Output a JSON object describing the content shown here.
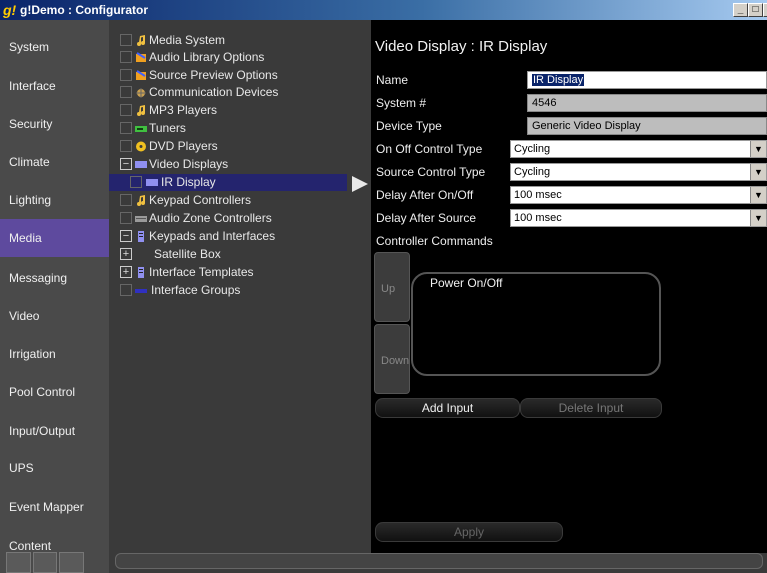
{
  "window": {
    "title": "g!Demo : Configurator",
    "icon": "g!-app-icon"
  },
  "nav": {
    "items": [
      {
        "label": "System"
      },
      {
        "label": "Interface"
      },
      {
        "label": "Security"
      },
      {
        "label": "Climate"
      },
      {
        "label": "Lighting"
      },
      {
        "label": "Media",
        "active": true
      },
      {
        "label": "Messaging"
      },
      {
        "label": "Video"
      },
      {
        "label": "Irrigation"
      },
      {
        "label": "Pool Control"
      },
      {
        "label": "Input/Output"
      },
      {
        "label": "UPS"
      },
      {
        "label": "Event Mapper"
      },
      {
        "label": "Content"
      }
    ]
  },
  "tree": {
    "items": [
      {
        "label": "Media System",
        "icon": "music-note-icon"
      },
      {
        "label": "Audio Library Options",
        "icon": "audio-library-icon"
      },
      {
        "label": "Source Preview Options",
        "icon": "source-preview-icon"
      },
      {
        "label": "Communication Devices",
        "icon": "communication-icon"
      },
      {
        "label": "MP3 Players",
        "icon": "music-note-icon"
      },
      {
        "label": "Tuners",
        "icon": "tuner-icon"
      },
      {
        "label": "DVD Players",
        "icon": "dvd-icon"
      },
      {
        "label": "Video Displays",
        "icon": "display-icon",
        "expander": "−"
      },
      {
        "label": "IR Display",
        "icon": "display-icon",
        "selected": true
      },
      {
        "label": "Keypad Controllers",
        "icon": "music-note-icon"
      },
      {
        "label": "Audio Zone Controllers",
        "icon": "audio-zone-icon"
      },
      {
        "label": "Keypads and Interfaces",
        "icon": "keypad-icon",
        "expander": "−"
      },
      {
        "label": "Satellite Box",
        "expander": "+"
      },
      {
        "label": "Interface Templates",
        "icon": "keypad-icon",
        "expander": "+"
      },
      {
        "label": "Interface Groups",
        "icon": "interface-group-icon"
      }
    ]
  },
  "detail": {
    "title": "Video Display : IR Display",
    "name_label": "Name",
    "name_value": "IR Display",
    "system_label": "System #",
    "system_value": "4546",
    "device_type_label": "Device Type",
    "device_type_value": "Generic Video Display",
    "onoff_label": "On Off Control Type",
    "onoff_value": "Cycling",
    "source_label": "Source Control Type",
    "source_value": "Cycling",
    "delay_onoff_label": "Delay After On/Off",
    "delay_onoff_value": "100 msec",
    "delay_source_label": "Delay After Source",
    "delay_source_value": "100 msec",
    "commands_label": "Controller Commands",
    "up_label": "Up",
    "down_label": "Down",
    "commands": [
      "Power On/Off"
    ],
    "add_input_label": "Add Input",
    "delete_input_label": "Delete Input",
    "apply_label": "Apply"
  },
  "colors": {
    "nav_active": "#5e4a9e",
    "tree_selected": "#24246e",
    "panel_bg": "#000000"
  }
}
